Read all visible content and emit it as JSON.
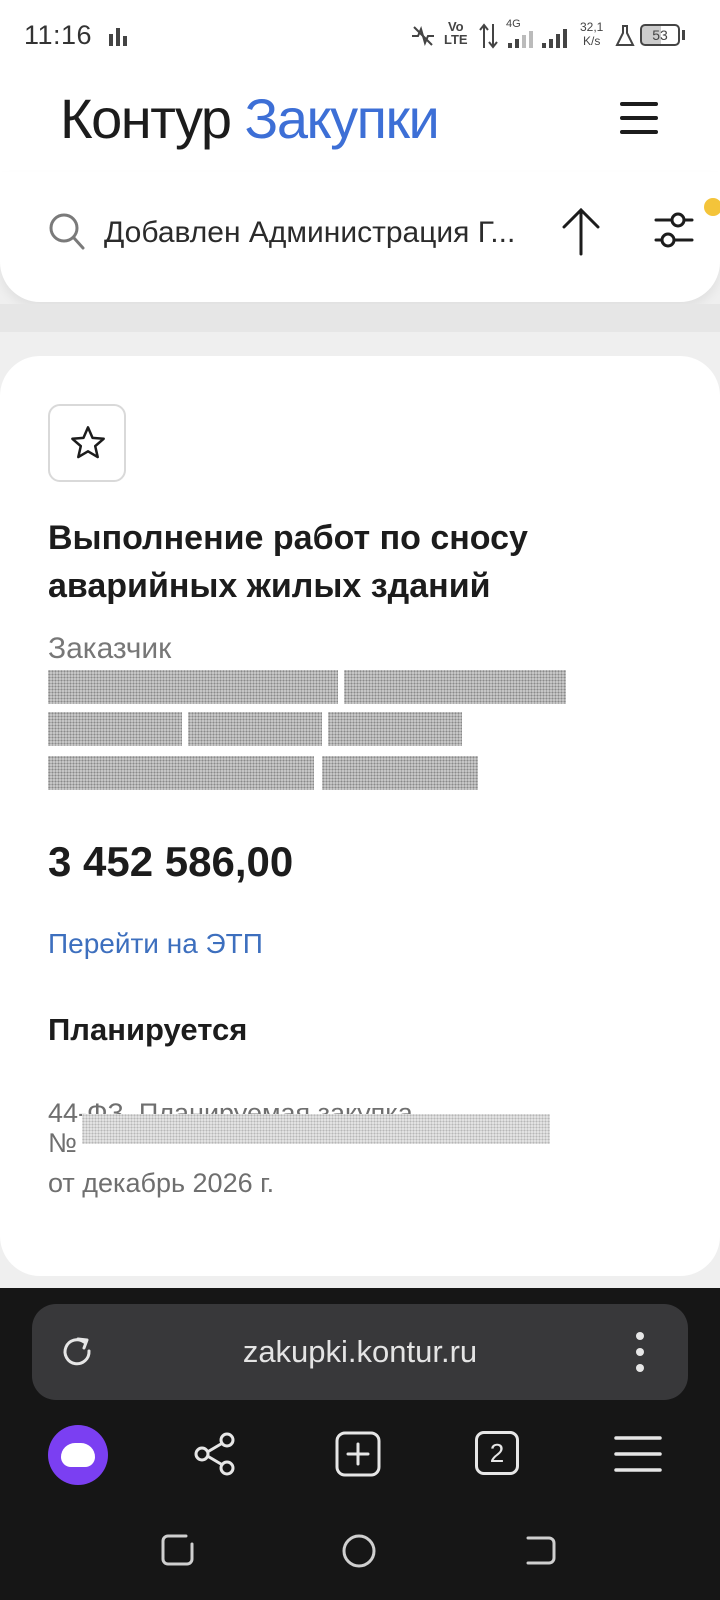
{
  "status_bar": {
    "time": "11:16",
    "volte_top": "Vo",
    "volte_bottom": "LTE",
    "network": "4G",
    "speed_value": "32,1",
    "speed_unit": "K/s",
    "battery": "53"
  },
  "header": {
    "logo_part1": "Контур",
    "logo_part2": "Закупки",
    "brand_color": "#3d6fd6"
  },
  "search": {
    "query": "Добавлен Администрация Г..."
  },
  "card": {
    "title": "Выполнение работ по сносу аварийных жилых зданий",
    "customer_label": "Заказчик",
    "price": "3 452 586,00",
    "etp_link": "Перейти на ЭТП",
    "status": "Планируется",
    "law_info": "44-ФЗ, Планируемая закупка",
    "number_label": "№",
    "date": "от декабрь 2026 г."
  },
  "browser": {
    "url": "zakupki.kontur.ru",
    "tabs_count": "2"
  },
  "icons": {
    "search": "search-icon",
    "upload": "arrow-up-icon",
    "filter": "filter-sliders-icon",
    "favorite": "star-icon",
    "reload": "reload-icon",
    "share": "share-icon",
    "new_tab": "new-tab-icon",
    "tabs": "tabs-icon",
    "menu": "hamburger-icon"
  }
}
